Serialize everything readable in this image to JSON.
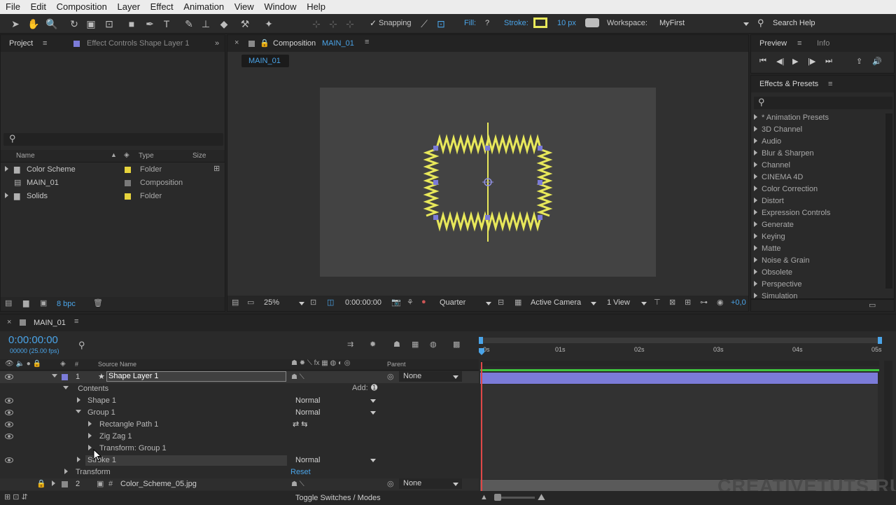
{
  "menu": [
    "File",
    "Edit",
    "Composition",
    "Layer",
    "Effect",
    "Animation",
    "View",
    "Window",
    "Help"
  ],
  "toolbar": {
    "snapping": "Snapping",
    "fill_label": "Fill:",
    "fill_value": "?",
    "stroke_label": "Stroke:",
    "stroke_width": "10 px",
    "workspace_label": "Workspace:",
    "workspace_value": "MyFirst",
    "search_help": "Search Help",
    "stroke_color": "#e8e85a"
  },
  "project_panel": {
    "tab_project": "Project",
    "tab_effect_controls": "Effect Controls Shape Layer 1",
    "col_name": "Name",
    "col_type": "Type",
    "col_size": "Size",
    "items": [
      {
        "name": "Color Scheme",
        "type": "Folder",
        "swatch": "#e6d33c",
        "icon": "folder-icon"
      },
      {
        "name": "MAIN_01",
        "type": "Composition",
        "swatch": "#7a7a7a",
        "icon": "composition-icon"
      },
      {
        "name": "Solids",
        "type": "Folder",
        "swatch": "#e6d33c",
        "icon": "folder-icon"
      }
    ],
    "bpc": "8 bpc"
  },
  "comp_panel": {
    "tab_prefix": "Composition",
    "tab_name": "MAIN_01",
    "sub_tab": "MAIN_01",
    "zoom": "25%",
    "timecode": "0:00:00:00",
    "resolution": "Quarter",
    "camera": "Active Camera",
    "views": "1 View",
    "exposure": "+0,0"
  },
  "preview_panel": {
    "tab_preview": "Preview",
    "tab_info": "Info"
  },
  "effects_panel": {
    "title": "Effects & Presets",
    "items": [
      "* Animation Presets",
      "3D Channel",
      "Audio",
      "Blur & Sharpen",
      "Channel",
      "CINEMA 4D",
      "Color Correction",
      "Distort",
      "Expression Controls",
      "Generate",
      "Keying",
      "Matte",
      "Noise & Grain",
      "Obsolete",
      "Perspective",
      "Simulation"
    ]
  },
  "timeline": {
    "tab_name": "MAIN_01",
    "timecode": "0:00:00:00",
    "fps": "00000 (25.00 fps)",
    "col_source_name": "Source Name",
    "col_parent": "Parent",
    "col_num": "#",
    "ruler": [
      "0s",
      "01s",
      "02s",
      "03s",
      "04s",
      "05s"
    ],
    "layer1": {
      "num": "1",
      "name": "Shape Layer 1",
      "parent": "None",
      "color": "#7b7bd8"
    },
    "contents": "Contents",
    "add": "Add:",
    "shape1": {
      "name": "Shape 1",
      "mode": "Normal"
    },
    "group1": {
      "name": "Group 1",
      "mode": "Normal"
    },
    "rect_path": "Rectangle Path 1",
    "zigzag": "Zig Zag 1",
    "transform_group": "Transform: Group 1",
    "stroke1": {
      "name": "Stroke 1",
      "mode": "Normal"
    },
    "transform": "Transform",
    "reset": "Reset",
    "layer2": {
      "num": "2",
      "name": "Color_Scheme_05.jpg",
      "parent": "None"
    },
    "toggle": "Toggle Switches / Modes"
  },
  "watermark": "CREATIVETUTS.RU",
  "colors": {
    "accent_blue": "#4aa4e8",
    "layer_bar": "#7b7bd8",
    "work_area": "#3ec43e",
    "playhead": "#e04848",
    "shape_stroke": "#e8e85a"
  }
}
